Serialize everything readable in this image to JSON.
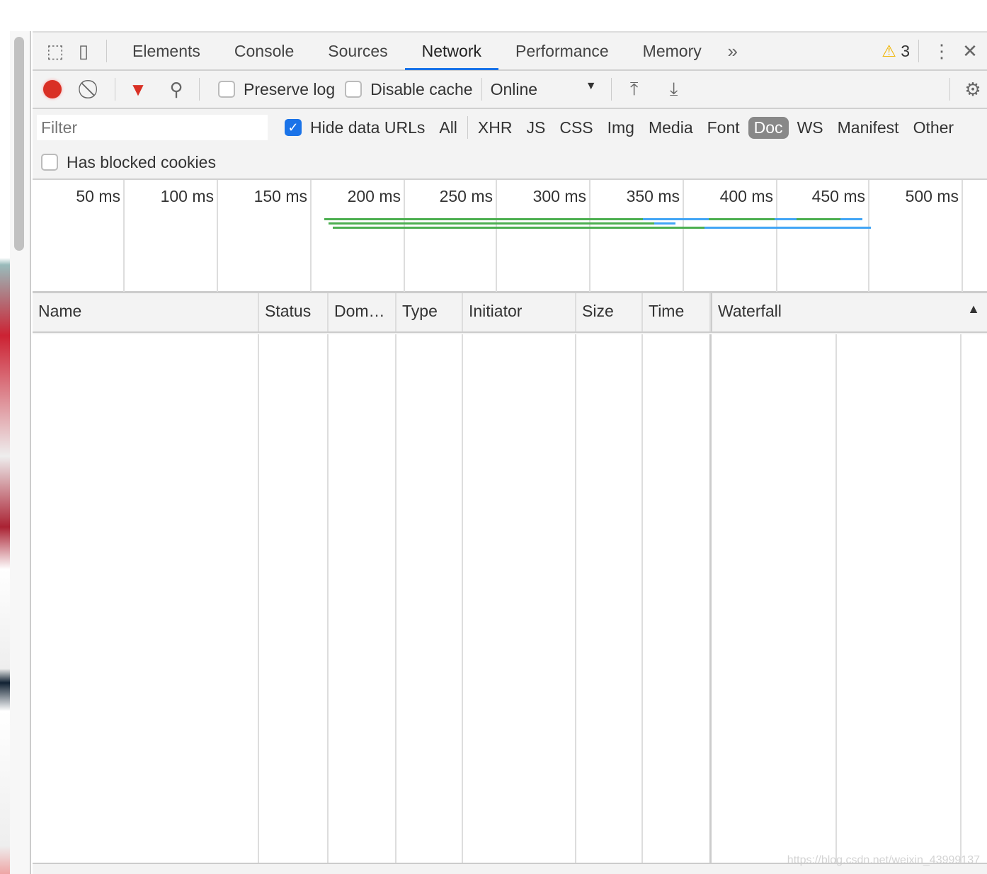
{
  "tabs": [
    "Elements",
    "Console",
    "Sources",
    "Network",
    "Performance",
    "Memory"
  ],
  "active_tab": "Network",
  "warnings_count": "3",
  "toolbar": {
    "preserve_log": "Preserve log",
    "disable_cache": "Disable cache",
    "throttle": "Online",
    "preserve_log_checked": false,
    "disable_cache_checked": false
  },
  "filter": {
    "placeholder": "Filter",
    "hide_data_urls": "Hide data URLs",
    "hide_data_urls_checked": true,
    "types": [
      "All",
      "XHR",
      "JS",
      "CSS",
      "Img",
      "Media",
      "Font",
      "Doc",
      "WS",
      "Manifest",
      "Other"
    ],
    "selected_type": "Doc",
    "has_blocked_cookies": "Has blocked cookies"
  },
  "overview_ticks": [
    "50 ms",
    "100 ms",
    "150 ms",
    "200 ms",
    "250 ms",
    "300 ms",
    "350 ms",
    "400 ms",
    "450 ms",
    "500 ms"
  ],
  "columns": [
    "Name",
    "Status",
    "Dom…",
    "Type",
    "Initiator",
    "Size",
    "Time",
    "Waterfall"
  ],
  "colors": {
    "accent": "#1a73e8",
    "record": "#d93025",
    "green": "#4caf50",
    "blue": "#42a5f5"
  },
  "watermark": "https://blog.csdn.net/weixin_43999137"
}
